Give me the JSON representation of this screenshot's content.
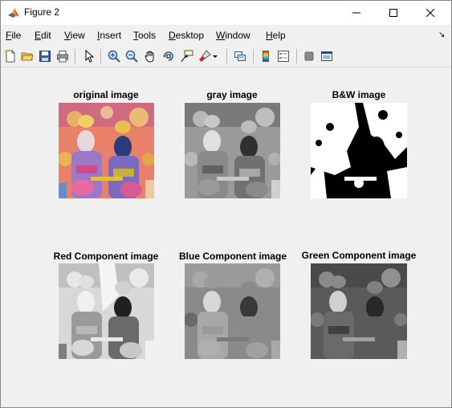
{
  "window": {
    "title": "Figure 2"
  },
  "menu": {
    "items": [
      {
        "accel": "F",
        "rest": "ile"
      },
      {
        "accel": "E",
        "rest": "dit"
      },
      {
        "accel": "V",
        "rest": "iew"
      },
      {
        "accel": "I",
        "rest": "nsert"
      },
      {
        "accel": "T",
        "rest": "ools"
      },
      {
        "accel": "D",
        "rest": "esktop"
      },
      {
        "accel": "W",
        "rest": "indow"
      },
      {
        "accel": "H",
        "rest": "elp"
      }
    ]
  },
  "toolbar": {
    "icons": [
      "new-figure-icon",
      "open-file-icon",
      "save-icon",
      "print-icon",
      "pointer-icon",
      "zoom-in-icon",
      "zoom-out-icon",
      "pan-hand-icon",
      "rotate-3d-icon",
      "data-cursor-icon",
      "brush-icon",
      "link-plot-icon",
      "colorbar-icon",
      "legend-icon",
      "hide-plot-tools-icon",
      "show-plot-tools-icon"
    ]
  },
  "panels": {
    "original": {
      "title": "original image"
    },
    "gray": {
      "title": "gray image"
    },
    "bw": {
      "title": "B&W image"
    },
    "red": {
      "title": "Red Component image"
    },
    "blue": {
      "title": "Blue Component image"
    },
    "green": {
      "title": "Green Component image"
    }
  },
  "colors": {
    "matlab_red": "#d9482a",
    "matlab_orange": "#f0a030",
    "background": "#f0f0f0"
  }
}
